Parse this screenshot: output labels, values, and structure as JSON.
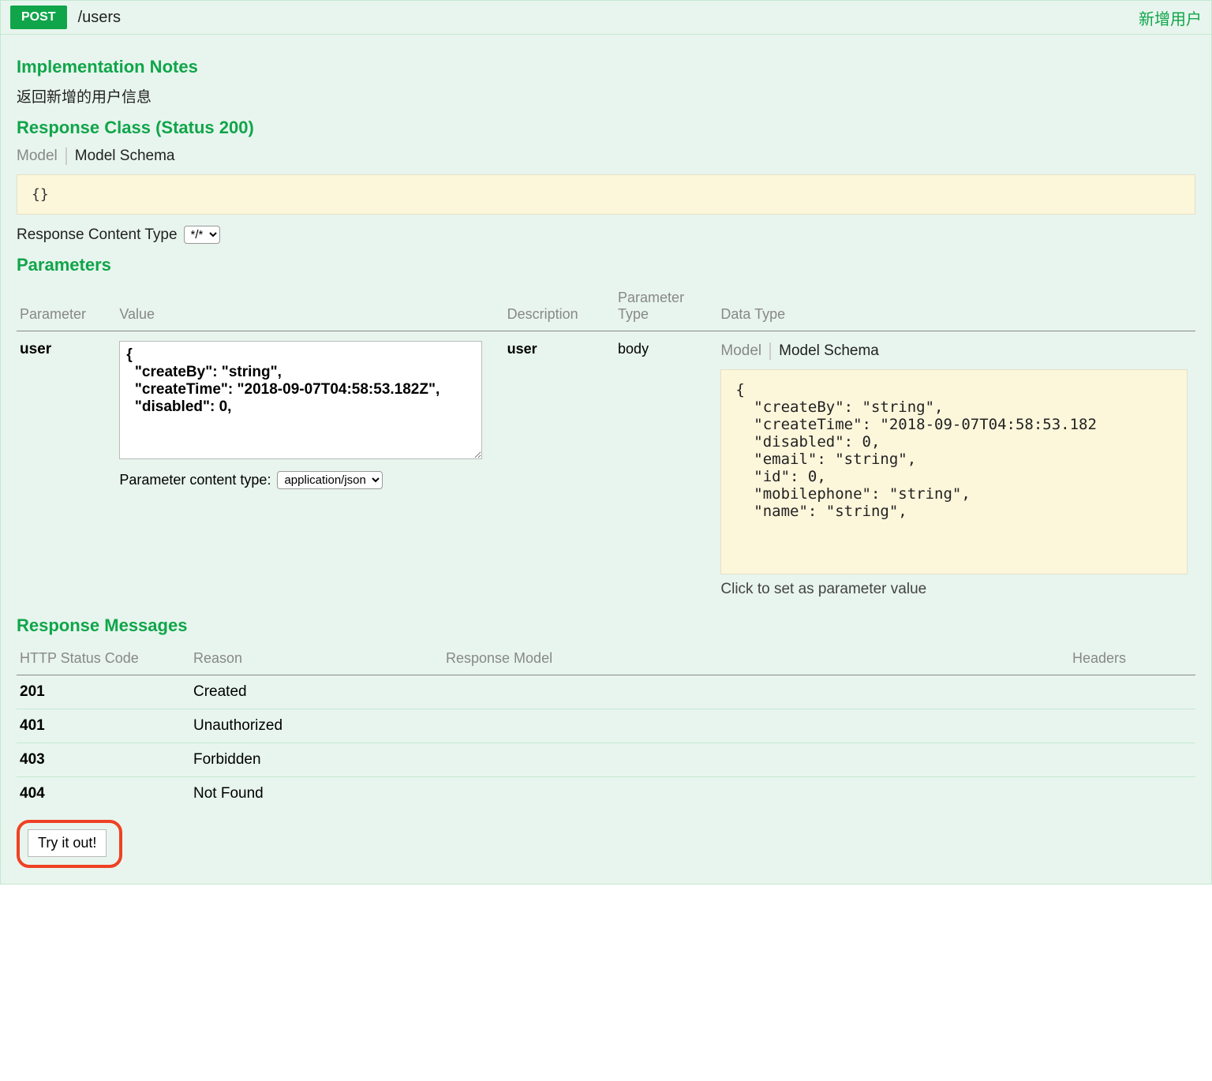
{
  "operation": {
    "method": "POST",
    "path": "/users",
    "summary": "新增用户"
  },
  "sections": {
    "implementation_notes_title": "Implementation Notes",
    "implementation_notes_text": "返回新增的用户信息",
    "response_class_title": "Response Class (Status 200)",
    "tabs": {
      "model": "Model",
      "schema": "Model Schema"
    },
    "response_schema": "{}",
    "response_content_type_label": "Response Content Type",
    "response_content_type_value": "*/*",
    "parameters_title": "Parameters",
    "parameters_headers": {
      "name": "Parameter",
      "value": "Value",
      "desc": "Description",
      "ptype": "Parameter Type",
      "dtype": "Data Type"
    },
    "parameter": {
      "name": "user",
      "value": "{\n  \"createBy\": \"string\",\n  \"createTime\": \"2018-09-07T04:58:53.182Z\",\n  \"disabled\": 0,",
      "param_content_type_label": "Parameter content type:",
      "param_content_type_value": "application/json",
      "description": "user",
      "param_type": "body",
      "datatype_schema": "{\n  \"createBy\": \"string\",\n  \"createTime\": \"2018-09-07T04:58:53.182\n  \"disabled\": 0,\n  \"email\": \"string\",\n  \"id\": 0,\n  \"mobilephone\": \"string\",\n  \"name\": \"string\",",
      "click_hint": "Click to set as parameter value"
    },
    "response_messages_title": "Response Messages",
    "response_messages_headers": {
      "code": "HTTP Status Code",
      "reason": "Reason",
      "model": "Response Model",
      "headers": "Headers"
    },
    "response_messages": [
      {
        "code": "201",
        "reason": "Created"
      },
      {
        "code": "401",
        "reason": "Unauthorized"
      },
      {
        "code": "403",
        "reason": "Forbidden"
      },
      {
        "code": "404",
        "reason": "Not Found"
      }
    ],
    "try_button": "Try it out!"
  }
}
